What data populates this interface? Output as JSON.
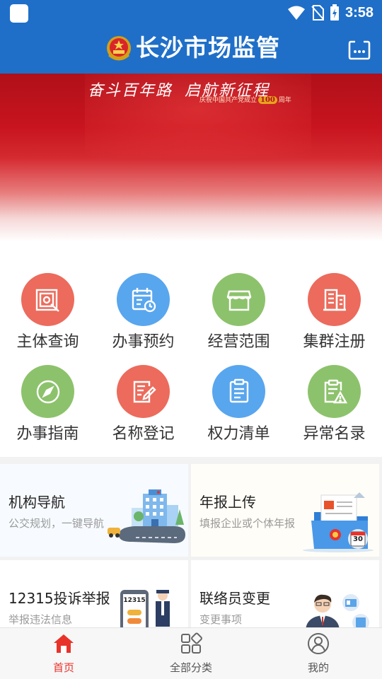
{
  "status_bar": {
    "time": "3:58"
  },
  "header": {
    "title": "长沙市场监管"
  },
  "banner": {
    "slogan_left": "奋斗百年路",
    "slogan_right": "启航新征程",
    "sub_before": "庆祝中国共产党成立",
    "sub_number": "100",
    "sub_after": "周年"
  },
  "services": [
    {
      "label": "主体查询",
      "icon": "enterprise-search-icon",
      "color": "#ec6b5c"
    },
    {
      "label": "办事预约",
      "icon": "calendar-clock-icon",
      "color": "#58a6ee"
    },
    {
      "label": "经营范围",
      "icon": "storefront-icon",
      "color": "#8dc26c"
    },
    {
      "label": "集群注册",
      "icon": "building-icon",
      "color": "#ec6b5c"
    },
    {
      "label": "办事指南",
      "icon": "compass-icon",
      "color": "#8dc26c"
    },
    {
      "label": "名称登记",
      "icon": "edit-document-icon",
      "color": "#ec6b5c"
    },
    {
      "label": "权力清单",
      "icon": "list-document-icon",
      "color": "#58a6ee"
    },
    {
      "label": "异常名录",
      "icon": "warning-clipboard-icon",
      "color": "#8dc26c"
    }
  ],
  "cards": [
    {
      "title": "机构导航",
      "subtitle": "公交规划，一键导航"
    },
    {
      "title": "年报上传",
      "subtitle": "填报企业或个体年报"
    },
    {
      "title": "12315投诉举报",
      "subtitle": "举报违法信息"
    },
    {
      "title": "联络员变更",
      "subtitle": "变更事项"
    }
  ],
  "card_art": {
    "phone_text": "12315",
    "calendar_text": "30"
  },
  "tabs": [
    {
      "label": "首页",
      "active": true
    },
    {
      "label": "全部分类",
      "active": false
    },
    {
      "label": "我的",
      "active": false
    }
  ],
  "colors": {
    "primary": "#1f6fc8",
    "active_tab": "#e8332b",
    "banner_red": "#c8141e"
  }
}
